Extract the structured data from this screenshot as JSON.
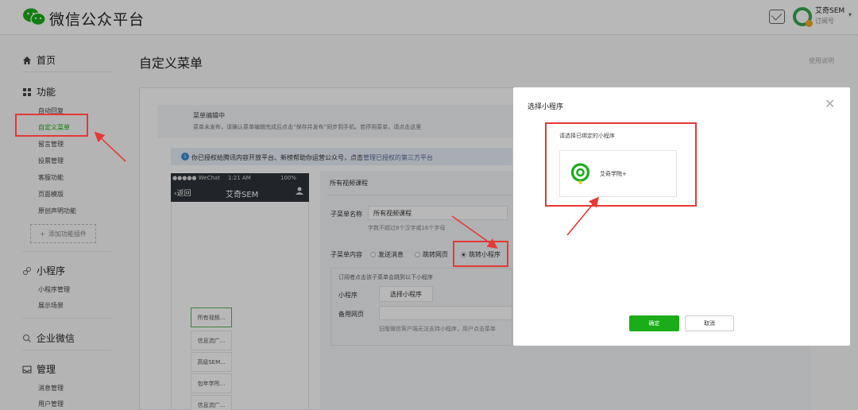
{
  "app": {
    "brand": "微信公众平台",
    "account_name": "艾奇SEM",
    "account_type": "订阅号"
  },
  "sidebar": {
    "home": "首页",
    "functions": {
      "label": "功能",
      "items": [
        "自动回复",
        "自定义菜单",
        "留言管理",
        "投票管理",
        "客服功能",
        "页面模版",
        "原创声明功能"
      ]
    },
    "add_plugin": "添加功能插件",
    "miniprogram": {
      "label": "小程序",
      "items": [
        "小程序管理",
        "展示场景"
      ]
    },
    "enterprise": {
      "label": "企业微信"
    },
    "manage": {
      "label": "管理",
      "items": [
        "消息管理",
        "用户管理"
      ]
    }
  },
  "page": {
    "title": "自定义菜单",
    "help": "使用说明"
  },
  "notice": {
    "title": "菜单编辑中",
    "desc": "菜单未发布，请确认菜单编辑完成后点击“保存并发布”同步到手机。若停用菜单，请点击这里"
  },
  "auth": {
    "text": "你已授权给腾讯内容开放平台、新榜帮助你运营公众号，点击管理已授权的第三方平台",
    "link": "管理已授权的第三方平台"
  },
  "phone": {
    "status_carrier": "●●●●● WeChat",
    "status_time": "1:21 AM",
    "status_battery": "100%",
    "back": "返回",
    "title": "艾奇SEM",
    "menu": [
      "所有视频...",
      "信息流广...",
      "高级SEM...",
      "包年学所...",
      "信息流广..."
    ]
  },
  "editor": {
    "title": "所有视频课程",
    "name_label": "子菜单名称",
    "name_value": "所有视频课程",
    "name_hint": "字数不超过8个汉字或16个字母",
    "content_label": "子菜单内容",
    "options": [
      "发送消息",
      "跳转网页",
      "跳转小程序"
    ],
    "selected": "跳转小程序",
    "sub_desc": "订阅者点击该子菜单会跳到以下小程序",
    "mp_label": "小程序",
    "mp_button": "选择小程序",
    "backup_label": "备用网页",
    "backup_hint": "旧版微信客户端无法支持小程序，用户点击菜单"
  },
  "modal": {
    "title": "选择小程序",
    "subtitle": "请选择已绑定的小程序",
    "miniprogram_name": "艾奇学院+",
    "ok": "确定",
    "cancel": "取消"
  },
  "colors": {
    "wechat_green": "#1aad19",
    "annotation_red": "#e53935",
    "link_blue": "#576b95"
  }
}
